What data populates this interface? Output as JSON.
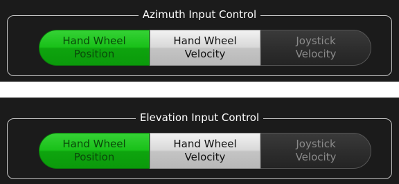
{
  "azimuth": {
    "title": "Azimuth Input Control",
    "options": [
      {
        "line1": "Hand Wheel",
        "line2": "Position"
      },
      {
        "line1": "Hand Wheel",
        "line2": "Velocity"
      },
      {
        "line1": "Joystick",
        "line2": "Velocity"
      }
    ],
    "selected": "Hand Wheel Position"
  },
  "elevation": {
    "title": "Elevation Input Control",
    "options": [
      {
        "line1": "Hand Wheel",
        "line2": "Position"
      },
      {
        "line1": "Hand Wheel",
        "line2": "Velocity"
      },
      {
        "line1": "Joystick",
        "line2": "Velocity"
      }
    ],
    "selected": "Hand Wheel Position"
  },
  "colors": {
    "panel_bg": "#1b1b1b",
    "selected_green": "#19c019",
    "light_button": "#d8d8d8",
    "dark_button": "#2e2e2e"
  }
}
